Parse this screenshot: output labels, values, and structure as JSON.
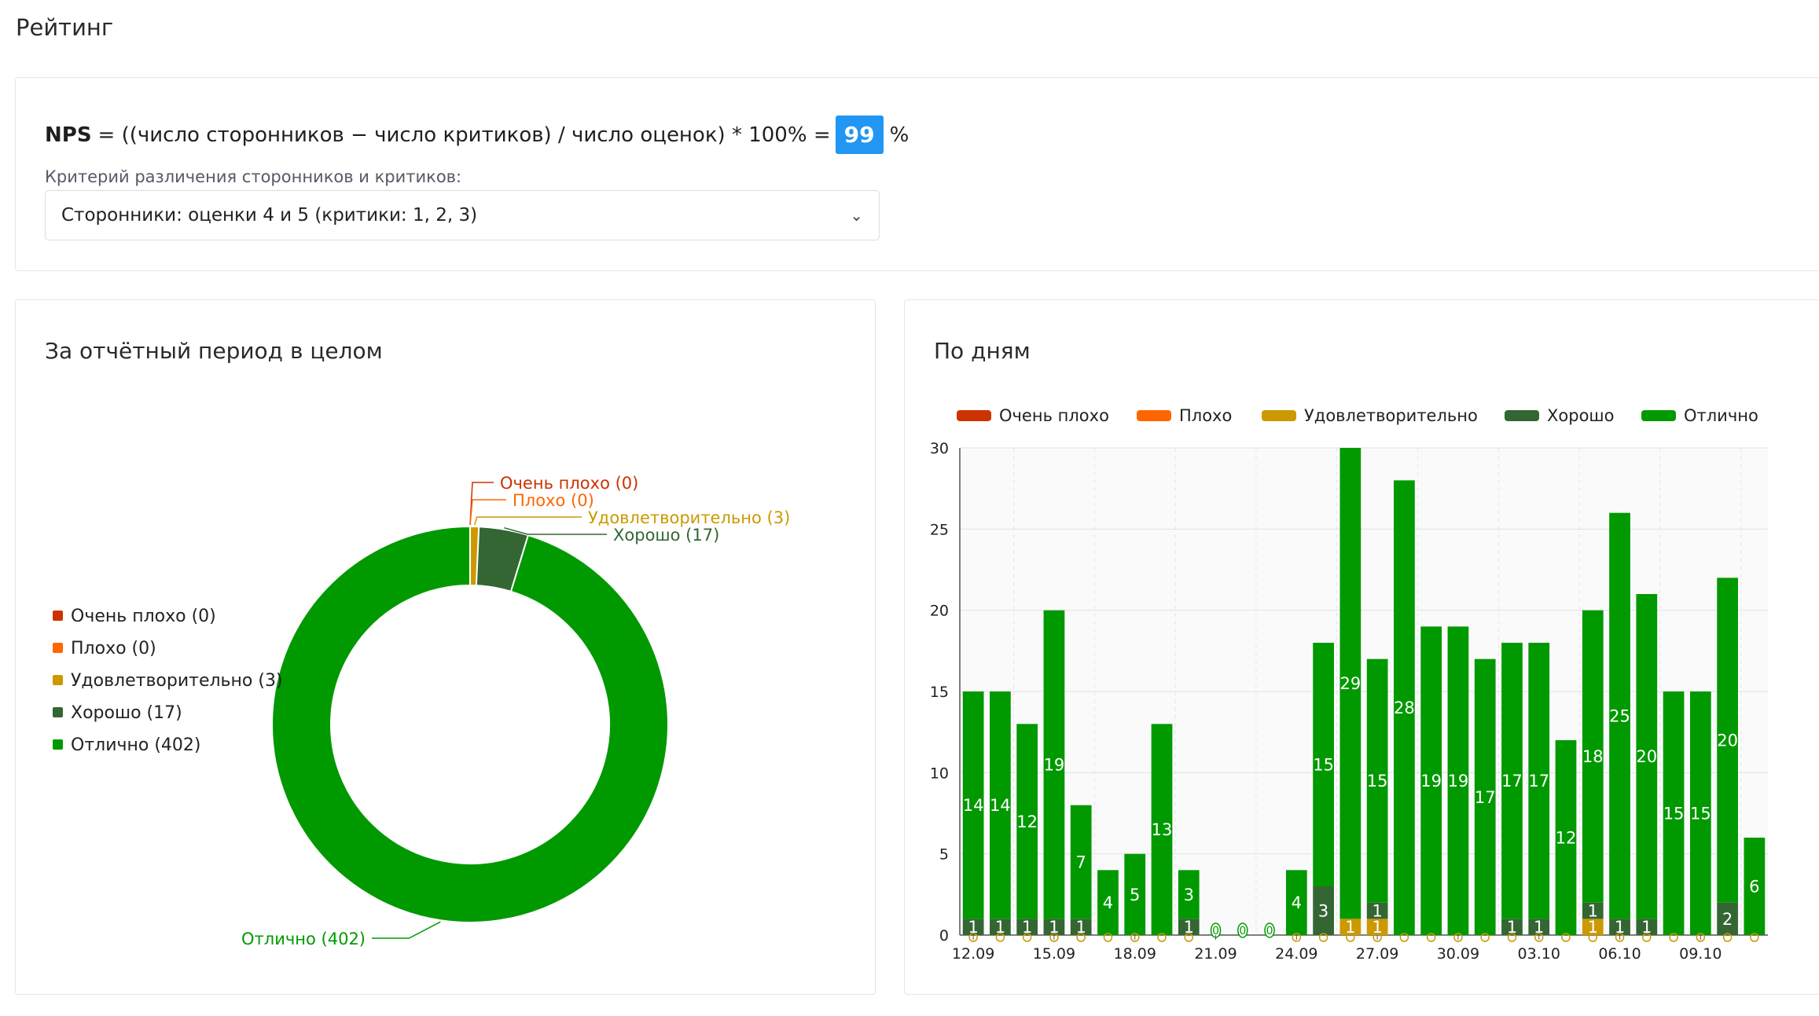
{
  "page": {
    "title": "Рейтинг"
  },
  "nps": {
    "label": "NPS",
    "formula": "= ((число сторонников − число критиков) / число оценок) * 100% =",
    "value": "99",
    "unit": "%",
    "criterion_label": "Критерий различения сторонников и критиков:",
    "criterion_selected": "Сторонники: оценки 4 и 5 (критики: 1, 2, 3)"
  },
  "colors": {
    "very_bad": "#cc3300",
    "bad": "#ff6600",
    "ok": "#cc9900",
    "good": "#336633",
    "excellent": "#009900"
  },
  "pie_card": {
    "title": "За отчётный период в целом"
  },
  "bar_card": {
    "title": "По дням"
  },
  "chart_data": [
    {
      "type": "pie",
      "donut": true,
      "legend_position": "left",
      "slices": [
        {
          "name": "Очень плохо",
          "value": 0,
          "label": "Очень плохо (0)",
          "color": "#cc3300"
        },
        {
          "name": "Плохо",
          "value": 0,
          "label": "Плохо (0)",
          "color": "#ff6600"
        },
        {
          "name": "Удовлетворительно",
          "value": 3,
          "label": "Удовлетворительно (3)",
          "color": "#cc9900"
        },
        {
          "name": "Хорошо",
          "value": 17,
          "label": "Хорошо (17)",
          "color": "#336633"
        },
        {
          "name": "Отлично",
          "value": 402,
          "label": "Отлично (402)",
          "color": "#009900"
        }
      ]
    },
    {
      "type": "bar",
      "stacked": true,
      "legend_position": "top",
      "ylim": [
        0,
        30
      ],
      "yticks": [
        0,
        5,
        10,
        15,
        20,
        25,
        30
      ],
      "grid": true,
      "x_tick_labels": [
        "12.09",
        "15.09",
        "18.09",
        "21.09",
        "24.09",
        "27.09",
        "30.09",
        "03.10",
        "06.10",
        "09.10"
      ],
      "categories": [
        "12.09",
        "13.09",
        "14.09",
        "15.09",
        "16.09",
        "17.09",
        "18.09",
        "19.09",
        "20.09",
        "21.09",
        "22.09",
        "23.09",
        "24.09",
        "25.09",
        "26.09",
        "27.09",
        "28.09",
        "29.09",
        "30.09",
        "01.10",
        "02.10",
        "03.10",
        "04.10",
        "05.10",
        "06.10",
        "07.10",
        "08.10",
        "09.10",
        "10.10",
        "11.10"
      ],
      "series": [
        {
          "name": "Очень плохо",
          "color": "#cc3300",
          "values": [
            0,
            0,
            0,
            0,
            0,
            0,
            0,
            0,
            0,
            0,
            0,
            0,
            0,
            0,
            0,
            0,
            0,
            0,
            0,
            0,
            0,
            0,
            0,
            0,
            0,
            0,
            0,
            0,
            0,
            0
          ]
        },
        {
          "name": "Плохо",
          "color": "#ff6600",
          "values": [
            0,
            0,
            0,
            0,
            0,
            0,
            0,
            0,
            0,
            0,
            0,
            0,
            0,
            0,
            0,
            0,
            0,
            0,
            0,
            0,
            0,
            0,
            0,
            0,
            0,
            0,
            0,
            0,
            0,
            0
          ]
        },
        {
          "name": "Удовлетворительно",
          "color": "#cc9900",
          "values": [
            0,
            0,
            0,
            0,
            0,
            0,
            0,
            0,
            0,
            0,
            0,
            0,
            0,
            0,
            1,
            1,
            0,
            0,
            0,
            0,
            0,
            0,
            0,
            1,
            0,
            0,
            0,
            0,
            0,
            0
          ]
        },
        {
          "name": "Хорошо",
          "color": "#336633",
          "values": [
            1,
            1,
            1,
            1,
            1,
            0,
            0,
            0,
            1,
            0,
            0,
            0,
            0,
            3,
            0,
            1,
            0,
            0,
            0,
            0,
            1,
            1,
            0,
            1,
            1,
            1,
            0,
            0,
            2,
            0
          ]
        },
        {
          "name": "Отлично",
          "color": "#009900",
          "values": [
            14,
            14,
            12,
            19,
            7,
            4,
            5,
            13,
            3,
            0,
            0,
            0,
            4,
            15,
            29,
            15,
            28,
            19,
            19,
            17,
            17,
            17,
            12,
            18,
            25,
            20,
            15,
            15,
            20,
            6
          ]
        }
      ]
    }
  ]
}
